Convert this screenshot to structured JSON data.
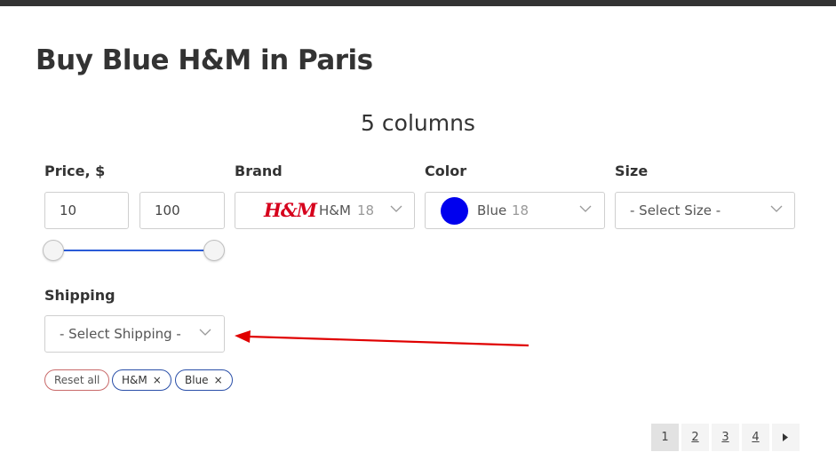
{
  "page": {
    "title": "Buy Blue H&M in Paris",
    "subheading": "5 columns"
  },
  "filters": {
    "price": {
      "label": "Price, $",
      "min": "10",
      "max": "100",
      "range_low": 0,
      "range_high": 1
    },
    "brand": {
      "label": "Brand",
      "logo_text": "H&M",
      "value": "H&M",
      "count": "18"
    },
    "color": {
      "label": "Color",
      "value": "Blue",
      "count": "18",
      "swatch": "#0000ee"
    },
    "size": {
      "label": "Size",
      "placeholder": "- Select Size -"
    },
    "shipping": {
      "label": "Shipping",
      "placeholder": "- Select Shipping -"
    }
  },
  "active_filters": {
    "reset_label": "Reset all",
    "chips": [
      "H&M",
      "Blue"
    ],
    "remove_glyph": "×"
  },
  "pagination": {
    "pages": [
      "1",
      "2",
      "3",
      "4"
    ],
    "current": "1",
    "next_icon": "next-page-icon"
  },
  "colors": {
    "accent": "#2a5bd7",
    "annotation_arrow": "#e00000",
    "brand_logo": "#d6001c",
    "reset_border": "#c96a6a",
    "chip_border": "#2a4fa8"
  }
}
